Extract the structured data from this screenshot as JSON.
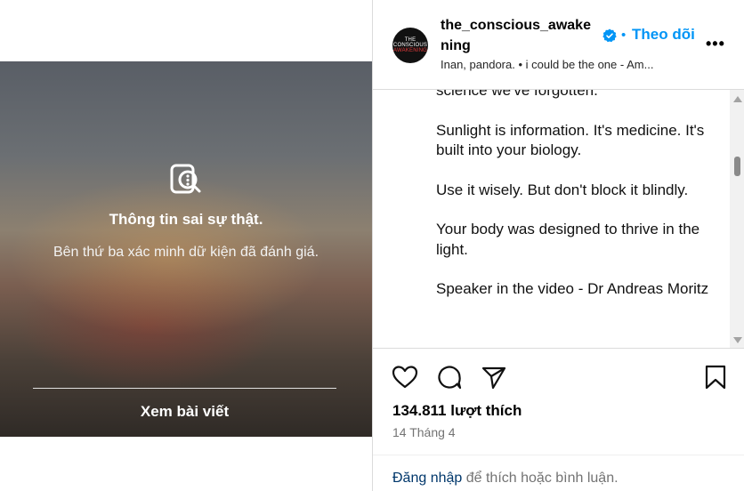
{
  "media": {
    "warning_title": "Thông tin sai sự thật.",
    "warning_subtitle": "Bên thứ ba xác minh dữ kiện đã đánh giá.",
    "view_post_label": "Xem bài viết",
    "icon": "fact-check-search-icon"
  },
  "header": {
    "avatar_text_top": "THE",
    "avatar_text_mid": "CONSCIOUS",
    "avatar_text_bot": "AWAKENING",
    "username": "the_conscious_awakening",
    "verified_icon": "verified-badge-icon",
    "separator": "•",
    "follow_label": "Theo dõi",
    "more_label": "•••",
    "audio_text": "Inan, pandora. • i could be the one - Am..."
  },
  "caption": {
    "lines": [
      "science we've forgotten.",
      "Sunlight is information. It's medicine. It's built into your biology.",
      "Use it wisely. But don't block it blindly.",
      "Your body was designed to thrive in the light.",
      "Speaker in the video - Dr Andreas Moritz"
    ]
  },
  "actions": {
    "like_icon": "heart-icon",
    "comment_icon": "comment-icon",
    "share_icon": "send-icon",
    "save_icon": "bookmark-icon"
  },
  "stats": {
    "likes": "134.811 lượt thích",
    "date": "14 Tháng 4"
  },
  "login": {
    "link_label": "Đăng nhập",
    "rest": " để thích hoặc bình luận."
  },
  "colors": {
    "accent": "#0095f6",
    "link": "#00376b",
    "muted": "#737373",
    "border": "#dbdbdb"
  }
}
